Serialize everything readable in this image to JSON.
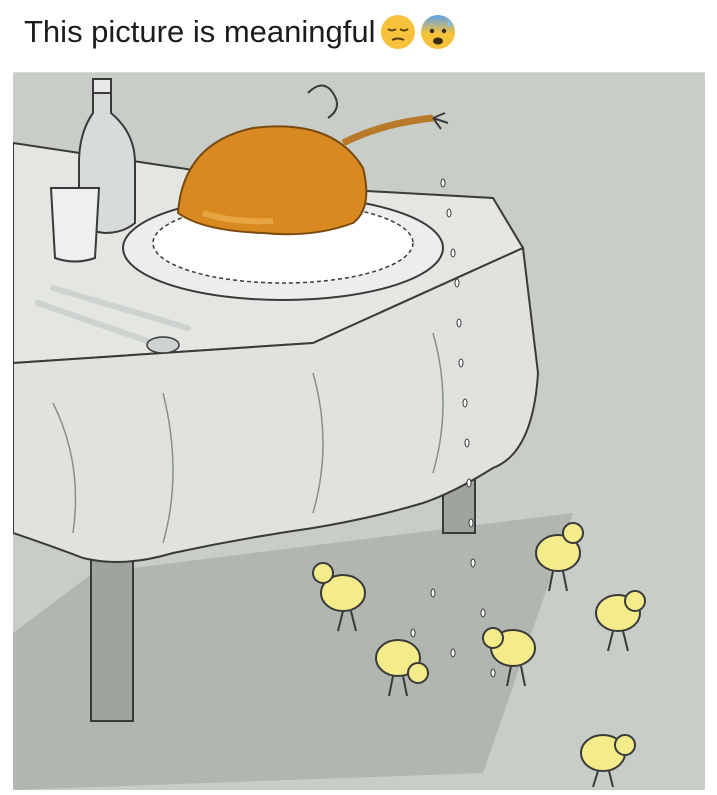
{
  "post": {
    "caption": "This picture is meaningful",
    "emojis": [
      "pensive-face-emoji",
      "anxious-face-with-sweat-emoji"
    ]
  },
  "image": {
    "subject": "cartoon-roast-chicken-dinner-table-with-chicks",
    "colors": {
      "background": "#c7ccc7",
      "tablecloth": "#e6e8e4",
      "outline": "#3a3a3a",
      "roast": "#d8891f",
      "chick": "#f4ec8a",
      "shadow": "#a9aea9"
    }
  }
}
